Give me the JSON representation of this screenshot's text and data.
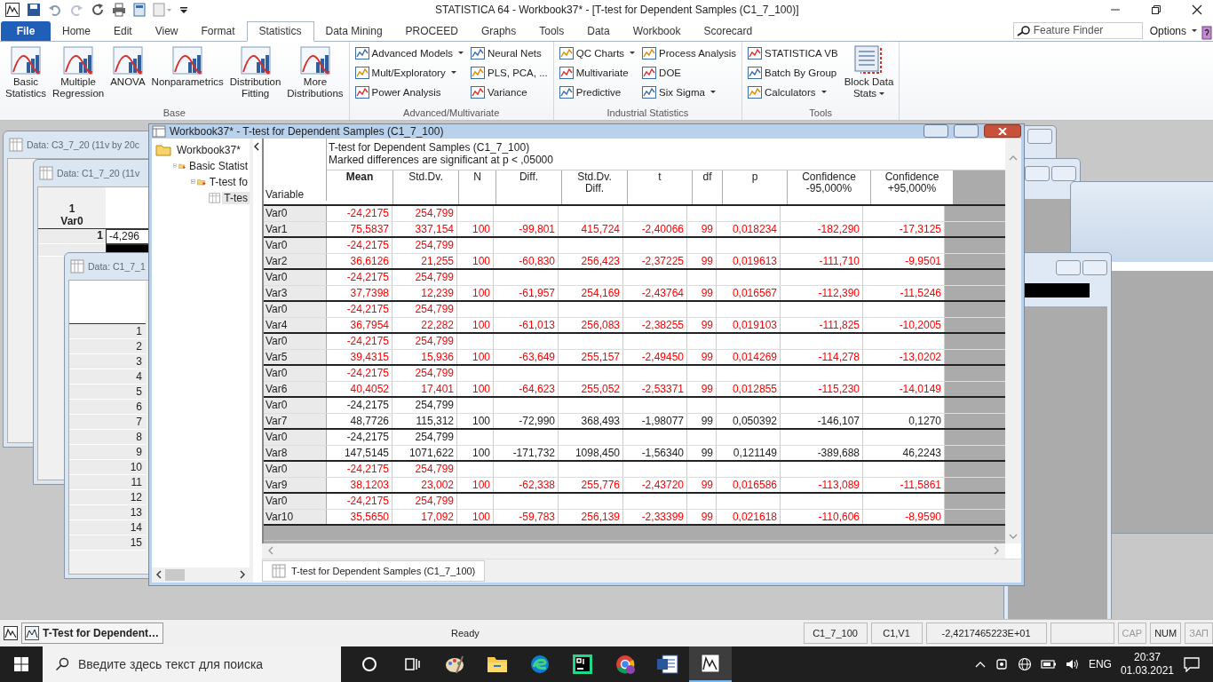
{
  "app": {
    "title": "STATISTICA 64 - Workbook37* - [T-test for Dependent Samples (C1_7_100)]"
  },
  "ribbon_tabs": [
    {
      "label": "File",
      "kind": "file",
      "selected": false
    },
    {
      "label": "Home",
      "kind": "tab",
      "selected": false
    },
    {
      "label": "Edit",
      "kind": "tab",
      "selected": false
    },
    {
      "label": "View",
      "kind": "tab",
      "selected": false
    },
    {
      "label": "Format",
      "kind": "tab",
      "selected": false
    },
    {
      "label": "Statistics",
      "kind": "tab",
      "selected": true
    },
    {
      "label": "Data Mining",
      "kind": "tab",
      "selected": false
    },
    {
      "label": "PROCEED",
      "kind": "tab",
      "selected": false
    },
    {
      "label": "Graphs",
      "kind": "tab",
      "selected": false
    },
    {
      "label": "Tools",
      "kind": "tab",
      "selected": false
    },
    {
      "label": "Data",
      "kind": "tab",
      "selected": false
    },
    {
      "label": "Workbook",
      "kind": "tab",
      "selected": false
    },
    {
      "label": "Scorecard",
      "kind": "tab",
      "selected": false
    }
  ],
  "feature_finder": {
    "placeholder": "Feature Finder"
  },
  "options": {
    "label": "Options"
  },
  "ribbon_groups": [
    {
      "title": "Base",
      "items": [
        {
          "label": "Basic\nStatistics",
          "kind": "large",
          "dropdown": false
        },
        {
          "label": "Multiple\nRegression",
          "kind": "large",
          "dropdown": false
        },
        {
          "label": "ANOVA",
          "kind": "large",
          "dropdown": false
        },
        {
          "label": "Nonparametrics",
          "kind": "large",
          "dropdown": false
        },
        {
          "label": "Distribution\nFitting",
          "kind": "large",
          "dropdown": false
        },
        {
          "label": "More\nDistributions",
          "kind": "large",
          "dropdown": false
        }
      ]
    },
    {
      "title": "Advanced/Multivariate",
      "items": [
        {
          "label": "Advanced Models",
          "kind": "small",
          "dropdown": true
        },
        {
          "label": "Mult/Exploratory",
          "kind": "small",
          "dropdown": true
        },
        {
          "label": "Power Analysis",
          "kind": "small",
          "dropdown": false
        },
        {
          "label": "Neural Nets",
          "kind": "small",
          "dropdown": false
        },
        {
          "label": "PLS, PCA, ...",
          "kind": "small",
          "dropdown": false
        },
        {
          "label": "Variance",
          "kind": "small",
          "dropdown": false
        }
      ]
    },
    {
      "title": "Industrial Statistics",
      "items": [
        {
          "label": "QC Charts",
          "kind": "small",
          "dropdown": true
        },
        {
          "label": "Multivariate",
          "kind": "small",
          "dropdown": false
        },
        {
          "label": "Predictive",
          "kind": "small",
          "dropdown": false
        },
        {
          "label": "Process Analysis",
          "kind": "small",
          "dropdown": false
        },
        {
          "label": "DOE",
          "kind": "small",
          "dropdown": false
        },
        {
          "label": "Six Sigma",
          "kind": "small",
          "dropdown": true
        }
      ]
    },
    {
      "title": "Tools",
      "items": [
        {
          "label": "STATISTICA VB",
          "kind": "small",
          "dropdown": false
        },
        {
          "label": "Batch By Group",
          "kind": "small",
          "dropdown": false
        },
        {
          "label": "Calculators",
          "kind": "small",
          "dropdown": true
        },
        {
          "label": "Block Data\nStats",
          "kind": "large",
          "dropdown": true
        }
      ]
    }
  ],
  "data_windows": [
    {
      "title": "Data: C3_7_20 (11v by 20c"
    },
    {
      "title": "Data: C1_7_20 (11v",
      "column_number": "1",
      "column_name": "Var0",
      "row_number": "1",
      "value": "-4,296"
    },
    {
      "title": "Data: C1_7_1",
      "row_numbers": [
        "1",
        "2",
        "3",
        "4",
        "5",
        "6",
        "7",
        "8",
        "9",
        "10",
        "11",
        "12",
        "13",
        "14",
        "15"
      ]
    }
  ],
  "workbook": {
    "title": "Workbook37* - T-test for Dependent Samples (C1_7_100)",
    "tree": [
      {
        "label": "Workbook37*",
        "kind": "folder",
        "selected": false,
        "children": [
          {
            "label": "Basic Statist",
            "kind": "folder",
            "expanded": true,
            "selected": false,
            "children": [
              {
                "label": "T-test fo",
                "kind": "folder",
                "expanded": true,
                "selected": false,
                "children": [
                  {
                    "label": "T-tes",
                    "kind": "sheet",
                    "selected": true
                  }
                ]
              }
            ]
          }
        ]
      }
    ],
    "sheet": {
      "title": "T-test for Dependent Samples (C1_7_100)",
      "subtitle": "Marked differences are significant at p < ,05000",
      "row_header_label": "Variable",
      "columns": [
        {
          "label": "Mean",
          "bold": true
        },
        {
          "label": "Std.Dv.",
          "bold": false
        },
        {
          "label": "N",
          "bold": false
        },
        {
          "label": "Diff.",
          "bold": false
        },
        {
          "label": "Std.Dv.\nDiff.",
          "bold": false
        },
        {
          "label": "t",
          "bold": false
        },
        {
          "label": "df",
          "bold": false
        },
        {
          "label": "p",
          "bold": false
        },
        {
          "label": "Confidence\n-95,000%",
          "bold": false
        },
        {
          "label": "Confidence\n+95,000%",
          "bold": false
        }
      ],
      "pairs": [
        {
          "significant": true,
          "first": {
            "variable": "Var0",
            "mean": "-24,2175",
            "std_dv": "254,799"
          },
          "second": {
            "variable": "Var1",
            "mean": "75,5837",
            "std_dv": "337,154",
            "n": "100",
            "diff": "-99,801",
            "std_dv_diff": "415,724",
            "t": "-2,40066",
            "df": "99",
            "p": "0,018234",
            "ci_low": "-182,290",
            "ci_high": "-17,3125"
          }
        },
        {
          "significant": true,
          "first": {
            "variable": "Var0",
            "mean": "-24,2175",
            "std_dv": "254,799"
          },
          "second": {
            "variable": "Var2",
            "mean": "36,6126",
            "std_dv": "21,255",
            "n": "100",
            "diff": "-60,830",
            "std_dv_diff": "256,423",
            "t": "-2,37225",
            "df": "99",
            "p": "0,019613",
            "ci_low": "-111,710",
            "ci_high": "-9,9501"
          }
        },
        {
          "significant": true,
          "first": {
            "variable": "Var0",
            "mean": "-24,2175",
            "std_dv": "254,799"
          },
          "second": {
            "variable": "Var3",
            "mean": "37,7398",
            "std_dv": "12,239",
            "n": "100",
            "diff": "-61,957",
            "std_dv_diff": "254,169",
            "t": "-2,43764",
            "df": "99",
            "p": "0,016567",
            "ci_low": "-112,390",
            "ci_high": "-11,5246"
          }
        },
        {
          "significant": true,
          "first": {
            "variable": "Var0",
            "mean": "-24,2175",
            "std_dv": "254,799"
          },
          "second": {
            "variable": "Var4",
            "mean": "36,7954",
            "std_dv": "22,282",
            "n": "100",
            "diff": "-61,013",
            "std_dv_diff": "256,083",
            "t": "-2,38255",
            "df": "99",
            "p": "0,019103",
            "ci_low": "-111,825",
            "ci_high": "-10,2005"
          }
        },
        {
          "significant": true,
          "first": {
            "variable": "Var0",
            "mean": "-24,2175",
            "std_dv": "254,799"
          },
          "second": {
            "variable": "Var5",
            "mean": "39,4315",
            "std_dv": "15,936",
            "n": "100",
            "diff": "-63,649",
            "std_dv_diff": "255,157",
            "t": "-2,49450",
            "df": "99",
            "p": "0,014269",
            "ci_low": "-114,278",
            "ci_high": "-13,0202"
          }
        },
        {
          "significant": true,
          "first": {
            "variable": "Var0",
            "mean": "-24,2175",
            "std_dv": "254,799"
          },
          "second": {
            "variable": "Var6",
            "mean": "40,4052",
            "std_dv": "17,401",
            "n": "100",
            "diff": "-64,623",
            "std_dv_diff": "255,052",
            "t": "-2,53371",
            "df": "99",
            "p": "0,012855",
            "ci_low": "-115,230",
            "ci_high": "-14,0149"
          }
        },
        {
          "significant": false,
          "first": {
            "variable": "Var0",
            "mean": "-24,2175",
            "std_dv": "254,799"
          },
          "second": {
            "variable": "Var7",
            "mean": "48,7726",
            "std_dv": "115,312",
            "n": "100",
            "diff": "-72,990",
            "std_dv_diff": "368,493",
            "t": "-1,98077",
            "df": "99",
            "p": "0,050392",
            "ci_low": "-146,107",
            "ci_high": "0,1270"
          }
        },
        {
          "significant": false,
          "first": {
            "variable": "Var0",
            "mean": "-24,2175",
            "std_dv": "254,799"
          },
          "second": {
            "variable": "Var8",
            "mean": "147,5145",
            "std_dv": "1071,622",
            "n": "100",
            "diff": "-171,732",
            "std_dv_diff": "1098,450",
            "t": "-1,56340",
            "df": "99",
            "p": "0,121149",
            "ci_low": "-389,688",
            "ci_high": "46,2243"
          }
        },
        {
          "significant": true,
          "first": {
            "variable": "Var0",
            "mean": "-24,2175",
            "std_dv": "254,799"
          },
          "second": {
            "variable": "Var9",
            "mean": "38,1203",
            "std_dv": "23,002",
            "n": "100",
            "diff": "-62,338",
            "std_dv_diff": "255,776",
            "t": "-2,43720",
            "df": "99",
            "p": "0,016586",
            "ci_low": "-113,089",
            "ci_high": "-11,5861"
          }
        },
        {
          "significant": true,
          "first": {
            "variable": "Var0",
            "mean": "-24,2175",
            "std_dv": "254,799"
          },
          "second": {
            "variable": "Var10",
            "mean": "35,5650",
            "std_dv": "17,092",
            "n": "100",
            "diff": "-59,783",
            "std_dv_diff": "256,139",
            "t": "-2,33399",
            "df": "99",
            "p": "0,021618",
            "ci_low": "-110,606",
            "ci_high": "-8,9590"
          }
        }
      ]
    },
    "sheet_tab": {
      "label": "T-test for Dependent Samples (C1_7_100)"
    }
  },
  "status_bar": {
    "task_button": "T-Test for Dependent…",
    "message": "Ready",
    "panes": [
      "C1_7_100",
      "C1,V1",
      "-2,4217465223E+01"
    ],
    "indicators": [
      {
        "label": "CAP",
        "on": false
      },
      {
        "label": "NUM",
        "on": true
      },
      {
        "label": "ЗАП",
        "on": false
      }
    ]
  },
  "taskbar": {
    "search": {
      "placeholder": "Введите здесь текст для поиска"
    },
    "apps": [
      {
        "kind": "circle",
        "active": false
      },
      {
        "kind": "taskview",
        "active": false
      },
      {
        "kind": "paint",
        "active": false
      },
      {
        "kind": "folder",
        "active": false
      },
      {
        "kind": "edge",
        "active": false
      },
      {
        "kind": "ide",
        "active": false
      },
      {
        "kind": "chrome",
        "active": false
      },
      {
        "kind": "word",
        "active": false
      },
      {
        "kind": "statistica",
        "active": true
      }
    ],
    "language": "ENG",
    "time": "20:37",
    "date": "01.03.2021"
  }
}
